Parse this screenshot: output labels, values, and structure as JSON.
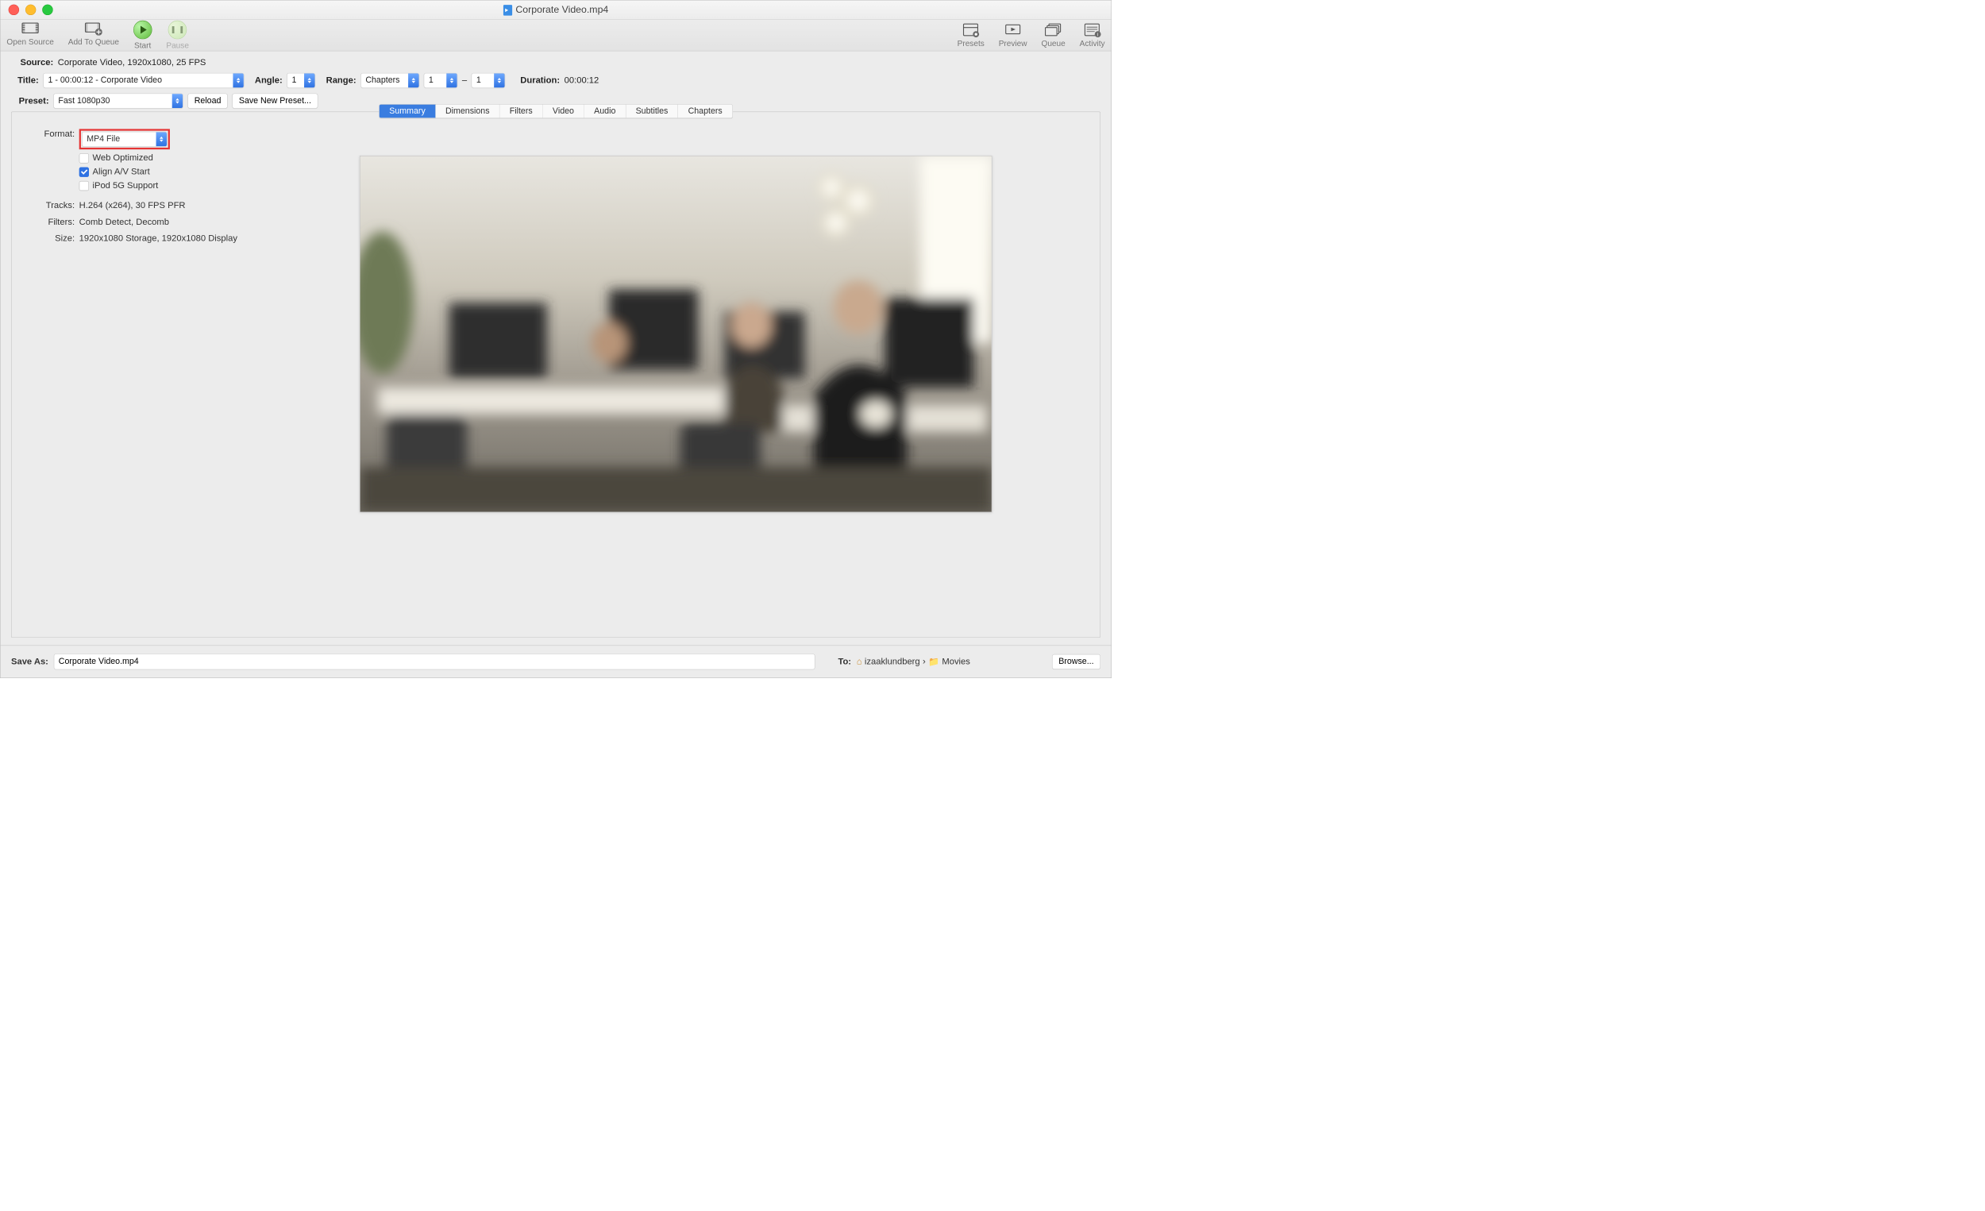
{
  "window": {
    "title": "Corporate Video.mp4"
  },
  "toolbar": {
    "open_source": "Open Source",
    "add_to_queue": "Add To Queue",
    "start": "Start",
    "pause": "Pause",
    "presets": "Presets",
    "preview": "Preview",
    "queue": "Queue",
    "activity": "Activity"
  },
  "info": {
    "source_label": "Source:",
    "source_value": "Corporate Video, 1920x1080, 25 FPS",
    "title_label": "Title:",
    "title_value": "1 - 00:00:12 - Corporate Video",
    "angle_label": "Angle:",
    "angle_value": "1",
    "range_label": "Range:",
    "range_type": "Chapters",
    "range_from": "1",
    "range_sep": "–",
    "range_to": "1",
    "duration_label": "Duration:",
    "duration_value": "00:00:12",
    "preset_label": "Preset:",
    "preset_value": "Fast 1080p30",
    "reload": "Reload",
    "save_new_preset": "Save New Preset..."
  },
  "tabs": {
    "summary": "Summary",
    "dimensions": "Dimensions",
    "filters": "Filters",
    "video": "Video",
    "audio": "Audio",
    "subtitles": "Subtitles",
    "chapters": "Chapters"
  },
  "summary": {
    "format_label": "Format:",
    "format_value": "MP4 File",
    "web_optimized": "Web Optimized",
    "align_av": "Align A/V Start",
    "ipod": "iPod 5G Support",
    "tracks_label": "Tracks:",
    "tracks_value": "H.264 (x264), 30 FPS PFR",
    "filters_label": "Filters:",
    "filters_value": "Comb Detect, Decomb",
    "size_label": "Size:",
    "size_value": "1920x1080 Storage, 1920x1080 Display"
  },
  "save": {
    "label": "Save As:",
    "value": "Corporate Video.mp4",
    "to_label": "To:",
    "path_user": "izaaklundberg",
    "path_sep": "›",
    "path_folder": "Movies",
    "browse": "Browse..."
  }
}
